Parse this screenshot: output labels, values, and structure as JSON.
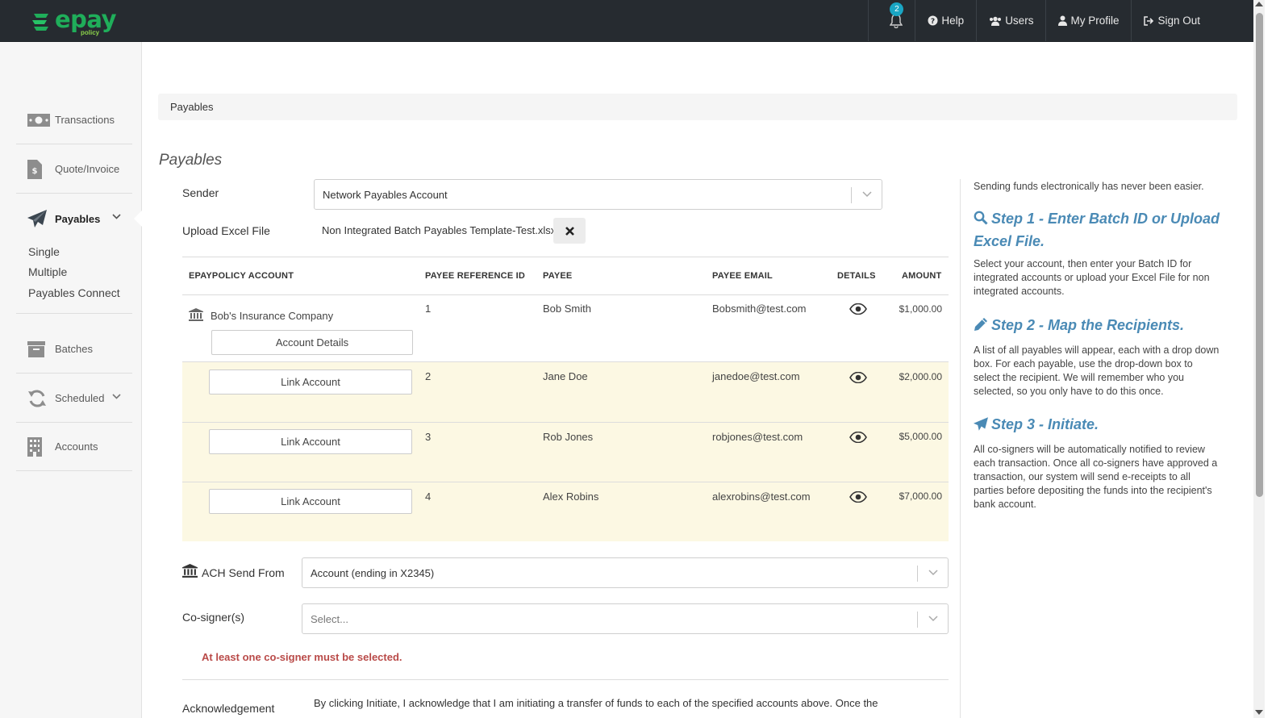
{
  "brand": {
    "name": "epay",
    "sub": "policy",
    "green": "#1fae5a",
    "accent_blue": "#4a8ab5",
    "error_red": "#b94a48",
    "highlight_row": "#fcf8e3"
  },
  "topnav": {
    "notifications_count": "2",
    "items": [
      {
        "label": "Help",
        "icon": "question-circle-icon"
      },
      {
        "label": "Users",
        "icon": "users-icon"
      },
      {
        "label": "My Profile",
        "icon": "user-icon"
      },
      {
        "label": "Sign Out",
        "icon": "sign-out-icon"
      }
    ]
  },
  "sidebar": {
    "items": [
      {
        "label": "Transactions",
        "icon": "money-icon"
      },
      {
        "label": "Quote/Invoice",
        "icon": "invoice-icon"
      },
      {
        "label": "Payables",
        "icon": "paper-plane-icon",
        "active": true
      },
      {
        "label": "Batches",
        "icon": "archive-icon"
      },
      {
        "label": "Scheduled",
        "icon": "refresh-icon"
      },
      {
        "label": "Accounts",
        "icon": "building-icon"
      }
    ],
    "payables_sub": [
      "Single",
      "Multiple",
      "Payables Connect"
    ]
  },
  "breadcrumb": "Payables",
  "page_title": "Payables",
  "form": {
    "sender_label": "Sender",
    "sender_value": "Network Payables Account",
    "upload_label": "Upload Excel File",
    "upload_filename": "Non Integrated Batch Payables Template-Test.xlsx",
    "ach_label": "ACH Send From",
    "ach_value": "Account (ending in X2345)",
    "cosigner_label": "Co-signer(s)",
    "cosigner_placeholder": "Select...",
    "cosigner_error": "At least one co-signer must be selected.",
    "ack_label": "Acknowledgement",
    "ack_text": "By clicking Initiate, I acknowledge that I am initiating a transfer of funds to each of the specified accounts above. Once the"
  },
  "table": {
    "headers": [
      "EPAYPOLICY ACCOUNT",
      "PAYEE REFERENCE ID",
      "PAYEE",
      "PAYEE EMAIL",
      "DETAILS",
      "AMOUNT"
    ],
    "rows": [
      {
        "account": "Bob's Insurance Company",
        "account_button": "Account Details",
        "ref": "1",
        "payee": "Bob Smith",
        "email": "Bobsmith@test.com",
        "amount": "$1,000.00"
      },
      {
        "account_button": "Link Account",
        "ref": "2",
        "payee": "Jane Doe",
        "email": "janedoe@test.com",
        "amount": "$2,000.00"
      },
      {
        "account_button": "Link Account",
        "ref": "3",
        "payee": "Rob Jones",
        "email": "robjones@test.com",
        "amount": "$5,000.00"
      },
      {
        "account_button": "Link Account",
        "ref": "4",
        "payee": "Alex Robins",
        "email": "alexrobins@test.com",
        "amount": "$7,000.00"
      }
    ]
  },
  "help": {
    "intro": "Sending funds electronically has never been easier.",
    "steps": [
      {
        "title": "Step 1 - Enter Batch ID or Upload Excel File.",
        "icon": "search-icon",
        "text": "Select your account, then enter your Batch ID for integrated accounts or upload your Excel File for non integrated accounts."
      },
      {
        "title": "Step 2 - Map the Recipients.",
        "icon": "pencil-icon",
        "text": "A list of all payables will appear, each with a drop down box. For each payable, use the drop-down box to select the recipient. We will remember who you selected, so you only have to do this once."
      },
      {
        "title": "Step 3 - Initiate.",
        "icon": "paper-plane-icon",
        "text": "All co-signers will be automatically notified to review each transaction. Once all co-signers have approved a transaction, our system will send e-receipts to all parties before depositing the funds into the recipient's bank account."
      }
    ]
  }
}
